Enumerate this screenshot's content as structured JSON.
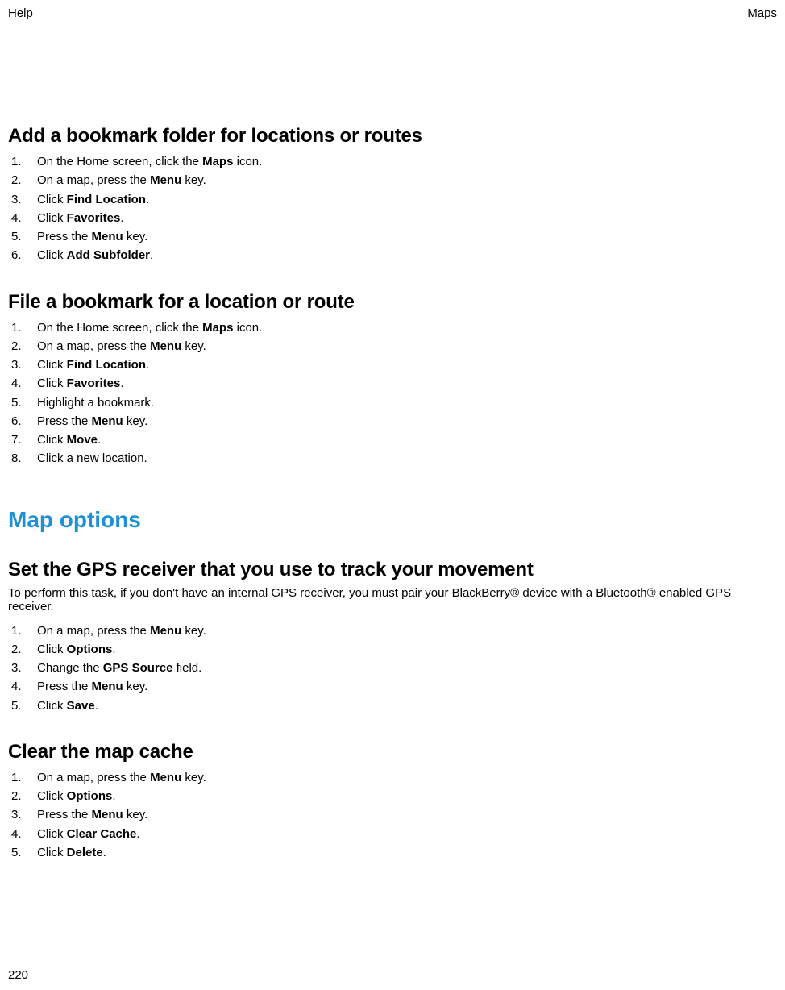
{
  "header": {
    "left": "Help",
    "right": "Maps"
  },
  "page_number": "220",
  "sections": {
    "s1": {
      "title": "Add a bookmark folder for locations or routes",
      "steps": [
        {
          "pre": "On the Home screen, click the ",
          "bold": "Maps",
          "post": " icon."
        },
        {
          "pre": "On a map, press the ",
          "bold": "Menu",
          "post": " key."
        },
        {
          "pre": "Click ",
          "bold": "Find Location",
          "post": "."
        },
        {
          "pre": "Click ",
          "bold": "Favorites",
          "post": "."
        },
        {
          "pre": "Press the ",
          "bold": "Menu",
          "post": " key."
        },
        {
          "pre": "Click ",
          "bold": "Add Subfolder",
          "post": "."
        }
      ]
    },
    "s2": {
      "title": "File a bookmark for a location or route",
      "steps": [
        {
          "pre": "On the Home screen, click the ",
          "bold": "Maps",
          "post": " icon."
        },
        {
          "pre": "On a map, press the ",
          "bold": "Menu",
          "post": " key."
        },
        {
          "pre": "Click ",
          "bold": "Find Location",
          "post": "."
        },
        {
          "pre": "Click ",
          "bold": "Favorites",
          "post": "."
        },
        {
          "pre": "Highlight a bookmark.",
          "bold": "",
          "post": ""
        },
        {
          "pre": "Press the ",
          "bold": "Menu",
          "post": " key."
        },
        {
          "pre": "Click ",
          "bold": "Move",
          "post": "."
        },
        {
          "pre": "Click a new location.",
          "bold": "",
          "post": ""
        }
      ]
    },
    "chapter": "Map options",
    "s3": {
      "title": "Set the GPS receiver that you use to track your movement",
      "intro": "To perform this task, if you don't have an internal GPS receiver, you must pair your BlackBerry® device with a Bluetooth® enabled GPS receiver.",
      "steps": [
        {
          "pre": "On a map, press the ",
          "bold": "Menu",
          "post": " key."
        },
        {
          "pre": "Click ",
          "bold": "Options",
          "post": "."
        },
        {
          "pre": "Change the ",
          "bold": "GPS Source",
          "post": " field."
        },
        {
          "pre": "Press the ",
          "bold": "Menu",
          "post": " key."
        },
        {
          "pre": "Click ",
          "bold": "Save",
          "post": "."
        }
      ]
    },
    "s4": {
      "title": "Clear the map cache",
      "steps": [
        {
          "pre": "On a map, press the ",
          "bold": "Menu",
          "post": " key."
        },
        {
          "pre": "Click ",
          "bold": "Options",
          "post": "."
        },
        {
          "pre": "Press the ",
          "bold": "Menu",
          "post": " key."
        },
        {
          "pre": "Click ",
          "bold": "Clear Cache",
          "post": "."
        },
        {
          "pre": "Click ",
          "bold": "Delete",
          "post": "."
        }
      ]
    }
  }
}
